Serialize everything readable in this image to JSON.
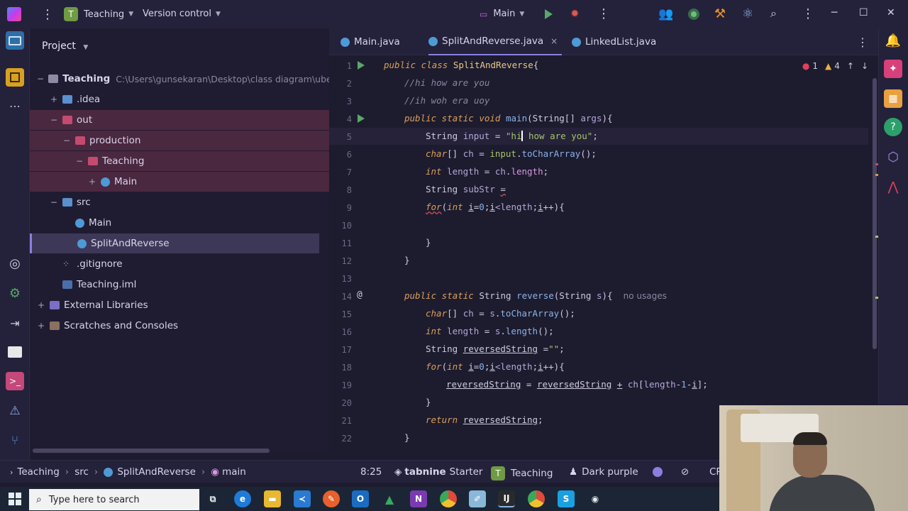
{
  "titlebar": {
    "project_badge": "T",
    "project_name": "Teaching",
    "vcs": "Version control",
    "run_config": "Main"
  },
  "project_panel": {
    "title": "Project",
    "tree": [
      {
        "label": "Teaching",
        "hint": "C:\\Users\\gunsekaran\\Desktop\\class diagram\\ube",
        "icon": "folder-icon",
        "expander": "−"
      },
      {
        "label": ".idea",
        "icon": "folder-icon",
        "expander": "+"
      },
      {
        "label": "out",
        "icon": "folder-icon",
        "expander": "−"
      },
      {
        "label": "production",
        "icon": "folder-icon",
        "expander": "−"
      },
      {
        "label": "Teaching",
        "icon": "folder-icon",
        "expander": "−"
      },
      {
        "label": "Main",
        "icon": "class-icon",
        "expander": "+"
      },
      {
        "label": "src",
        "icon": "source-folder-icon",
        "expander": "−"
      },
      {
        "label": "Main",
        "icon": "class-icon",
        "expander": ""
      },
      {
        "label": "SplitAndReverse",
        "icon": "class-icon",
        "expander": ""
      },
      {
        "label": ".gitignore",
        "icon": "file-icon",
        "expander": ""
      },
      {
        "label": "Teaching.iml",
        "icon": "file-icon",
        "expander": ""
      },
      {
        "label": "External Libraries",
        "icon": "library-icon",
        "expander": "+"
      },
      {
        "label": "Scratches and Consoles",
        "icon": "scratch-icon",
        "expander": "+"
      }
    ]
  },
  "tabs": [
    {
      "label": "Main.java"
    },
    {
      "label": "SplitAndReverse.java",
      "close": "×"
    },
    {
      "label": "LinkedList.java"
    }
  ],
  "editor": {
    "errors": "1",
    "warnings": "4",
    "line_numbers": [
      "1",
      "2",
      "3",
      "4",
      "5",
      "6",
      "7",
      "8",
      "9",
      "10",
      "11",
      "12",
      "13",
      "14",
      "15",
      "16",
      "17",
      "18",
      "19",
      "20",
      "21",
      "22"
    ],
    "usage_hint": "no usages"
  },
  "statusbar": {
    "crumb_project": "Teaching",
    "crumb_src": "src",
    "crumb_class": "SplitAndReverse",
    "crumb_method": "main",
    "position": "8:25",
    "tabnine_name": "tabnine",
    "tabnine_tier": "Starter",
    "project_badge": "T",
    "project": "Teaching",
    "theme": "Dark purple",
    "encoding": "CR"
  },
  "taskbar": {
    "search_placeholder": "Type here to search"
  },
  "colors": {
    "accent": "#8a7fe0",
    "run": "#59a869",
    "error": "#d25252",
    "project_badge": "#6e9b43"
  }
}
